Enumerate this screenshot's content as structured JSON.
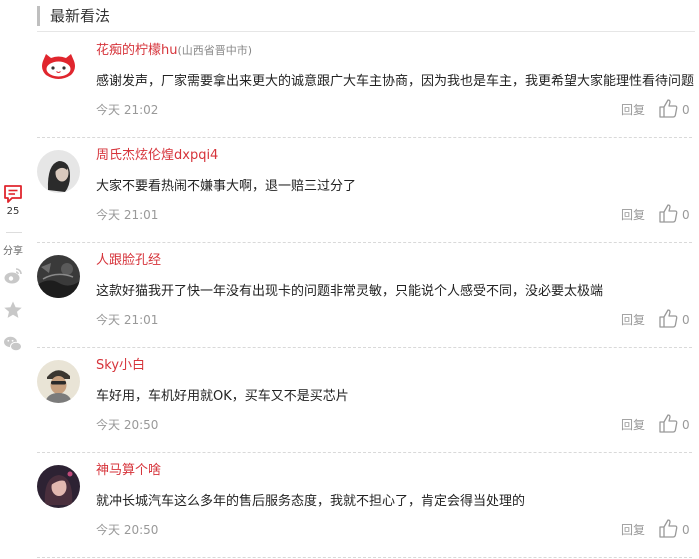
{
  "section_title": "最新看法",
  "sidebar": {
    "comment_count": "25",
    "share_label": "分享",
    "icons": [
      "comment-icon",
      "weibo-icon",
      "star-icon",
      "wechat-icon"
    ]
  },
  "comments": [
    {
      "user": "花痴的柠檬hu",
      "location": "(山西省晋中市)",
      "text": "感谢发声，厂家需要拿出来更大的诚意跟广大车主协商，因为我也是车主，我更希望大家能理性看待问题",
      "time": "今天 21:02",
      "reply": "回复",
      "likes": "0"
    },
    {
      "user": "周氏杰炫伦煌dxpqi4",
      "location": "",
      "text": "大家不要看热闹不嫌事大啊，退一赔三过分了",
      "time": "今天 21:01",
      "reply": "回复",
      "likes": "0"
    },
    {
      "user": "人跟脸孔经",
      "location": "",
      "text": "这款好猫我开了快一年没有出现卡的问题非常灵敏，只能说个人感受不同，没必要太极端",
      "time": "今天 21:01",
      "reply": "回复",
      "likes": "0"
    },
    {
      "user": "Sky小白",
      "location": "",
      "text": "车好用，车机好用就OK，买车又不是买芯片",
      "time": "今天 20:50",
      "reply": "回复",
      "likes": "0"
    },
    {
      "user": "神马算个啥",
      "location": "",
      "text": "就冲长城汽车这么多年的售后服务态度，我就不担心了，肯定会得当处理的",
      "time": "今天 20:50",
      "reply": "回复",
      "likes": "0"
    }
  ],
  "colors": {
    "username": "#d6343b",
    "accent_icon": "#e0262e",
    "meta": "#999999"
  }
}
